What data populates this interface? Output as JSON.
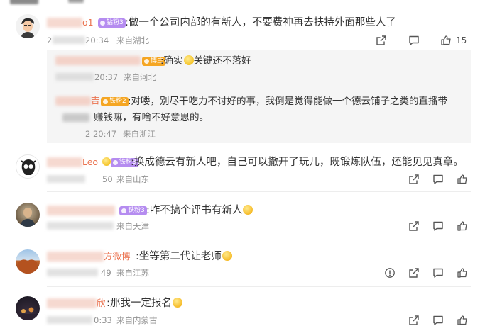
{
  "header": {
    "top_partial": "…"
  },
  "comments": [
    {
      "badge": "钻粉3",
      "nick_tail": "o1",
      "text": ":做一个公司内部的有新人，不要费神再去扶持外面那些人了",
      "time": "20:34",
      "location": "来自湖北",
      "likes": "15",
      "time_prefix": "2"
    },
    {
      "badge": "铁粉3",
      "nick_tail": "Leo",
      "text": ":换成德云有新人吧，自己可以撤开了玩儿，既锻炼队伍，还能见见真章。",
      "time": "50",
      "location": "来自山东"
    },
    {
      "badge": "铁粉3",
      "nick_tail": "",
      "text": ":咋不搞个评书有新人",
      "location": "来自天津"
    },
    {
      "nick_tail": "方微博",
      "text": ":坐等第二代让老师",
      "time": "49",
      "location": "来自江苏"
    },
    {
      "nick_tail": "欣",
      "text": ":那我一定报名",
      "time": "0:33",
      "location": "来自内蒙古"
    }
  ],
  "replies": [
    {
      "badge": "博主",
      "text": ":确实",
      "text_after": "关键还不落好",
      "time": "20:37",
      "location": "来自河北"
    },
    {
      "nick_tail": "吉",
      "badge": "铁粉2",
      "text_line1": ":对喽，别尽干吃力不讨好的事，我倒是觉得能做一个德云铺子之类的直播带",
      "text_line2": "赚钱嘛，有啥不好意思的。",
      "time": "2 20:47",
      "location": "来自浙江"
    }
  ],
  "icons": {
    "share": "share-icon",
    "comment": "comment-icon",
    "like": "like-icon",
    "report": "report-icon"
  },
  "colors": {
    "nick": "#eb7350",
    "badge_purple": "#b58cf0",
    "badge_orange": "#f5a623",
    "meta": "#939393",
    "reply_bg": "#f5f5f5"
  }
}
